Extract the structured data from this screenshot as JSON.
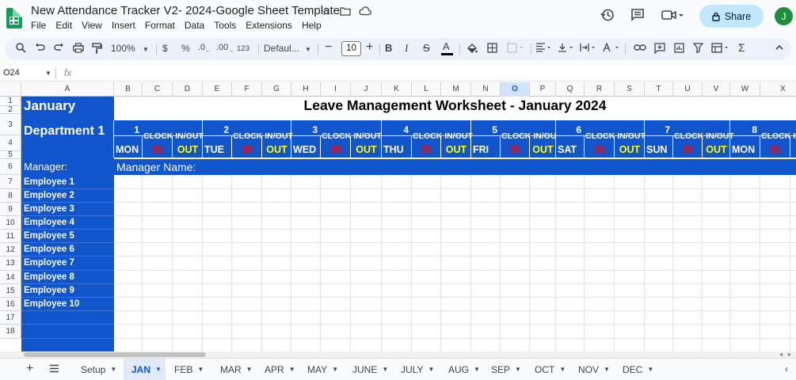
{
  "app": {
    "doc_title": "New Attendance Tracker V2- 2024-Google Sheet Template",
    "menu": [
      "File",
      "Edit",
      "View",
      "Insert",
      "Format",
      "Data",
      "Tools",
      "Extensions",
      "Help"
    ],
    "share_label": "Share",
    "avatar_initial": "J"
  },
  "toolbar": {
    "zoom": "100%",
    "currency": "$",
    "percent": "%",
    "dec_decrease": ".0←",
    "dec_increase": ".00",
    "number_format": "123",
    "font": "Defaul...",
    "font_size": "10"
  },
  "formula_bar": {
    "name_box": "O24",
    "fx": "fx",
    "value": ""
  },
  "columns": [
    "A",
    "B",
    "C",
    "D",
    "E",
    "F",
    "G",
    "H",
    "I",
    "J",
    "K",
    "L",
    "M",
    "N",
    "O",
    "P",
    "Q",
    "R",
    "S",
    "T",
    "U",
    "V",
    "W",
    "X"
  ],
  "selected_column": "O",
  "rows": [
    "1",
    "2",
    "3",
    "4",
    "5",
    "6",
    "7",
    "8",
    "9",
    "10",
    "11",
    "12",
    "13",
    "14",
    "15",
    "16",
    "17",
    "18"
  ],
  "sheet": {
    "month": "January",
    "title": "Leave Management Worksheet - January 2024",
    "department": "Department 1",
    "manager_label": "Manager:",
    "manager_name_label": "Manager Name:",
    "clock_label": "CLOCK IN/OUT",
    "clock_label_short": "CLOCK IN/OU",
    "in_label": "IN",
    "out_label": "OUT",
    "days": [
      {
        "num": "1",
        "name": "MON"
      },
      {
        "num": "2",
        "name": "TUE"
      },
      {
        "num": "3",
        "name": "WED"
      },
      {
        "num": "4",
        "name": "THU"
      },
      {
        "num": "5",
        "name": "FRI"
      },
      {
        "num": "6",
        "name": "SAT"
      },
      {
        "num": "7",
        "name": "SUN"
      },
      {
        "num": "8",
        "name": "MON"
      }
    ],
    "employees": [
      "Employee 1",
      "Employee 2",
      "Employee 3",
      "Employee 4",
      "Employee 5",
      "Employee 6",
      "Employee 7",
      "Employee 8",
      "Employee 9",
      "Employee 10"
    ]
  },
  "tabs": [
    "Setup",
    "JAN",
    "FEB",
    "MAR",
    "APR",
    "MAY",
    "JUNE",
    "JULY",
    "AUG",
    "SEP",
    "OCT",
    "NOV",
    "DEC"
  ],
  "active_tab": "JAN",
  "colors": {
    "header_blue": "#1155cc",
    "in_red": "#ff0000",
    "out_yellow": "#ffff00",
    "share_bg": "#c2e7ff",
    "sheets_green": "#0f9d58"
  }
}
